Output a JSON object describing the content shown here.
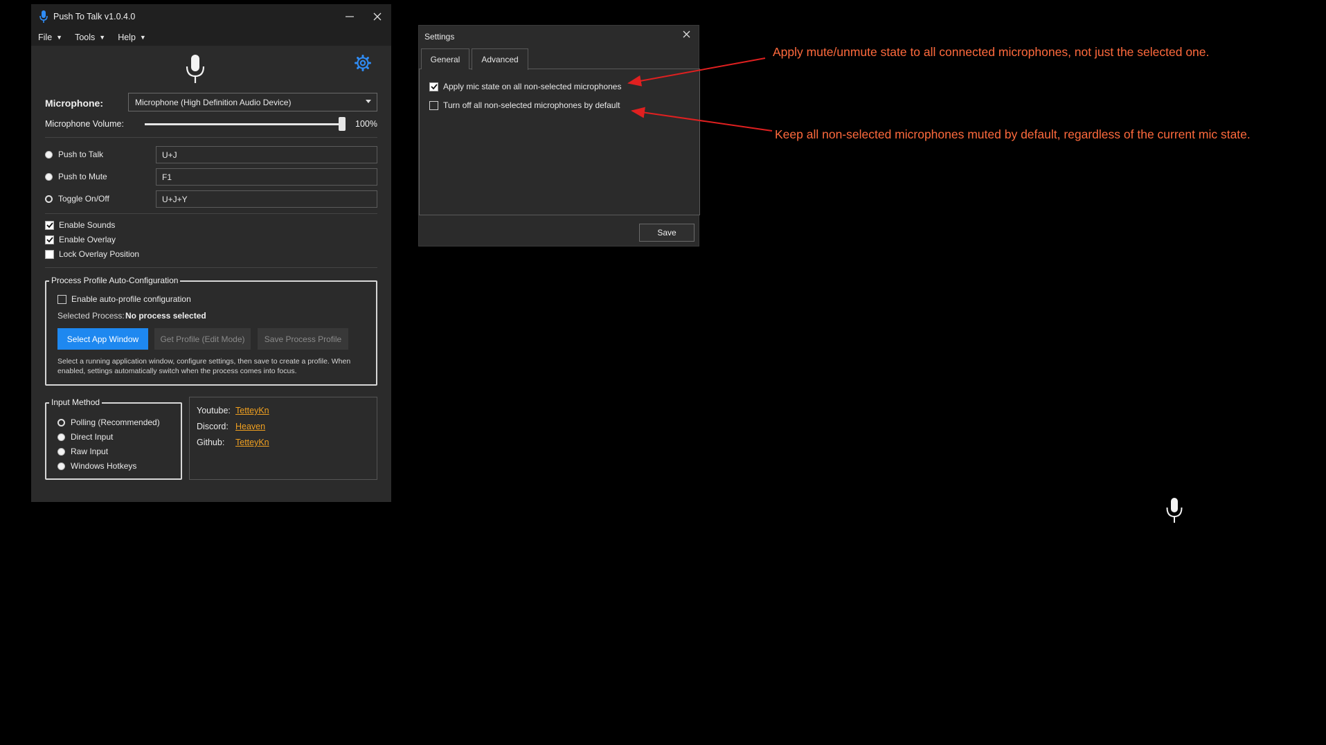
{
  "main_window": {
    "title": "Push To Talk v1.0.4.0",
    "menu": [
      "File",
      "Tools",
      "Help"
    ],
    "microphone_label": "Microphone:",
    "microphone_selected": "Microphone (High Definition Audio Device)",
    "volume_label": "Microphone Volume:",
    "volume_value": "100%",
    "volume_level": 1.0,
    "modes": [
      {
        "label": "Push to Talk",
        "hotkey": "U+J",
        "selected": false
      },
      {
        "label": "Push to Mute",
        "hotkey": "F1",
        "selected": false
      },
      {
        "label": "Toggle On/Off",
        "hotkey": "U+J+Y",
        "selected": true
      }
    ],
    "options": [
      {
        "label": "Enable Sounds",
        "checked": true
      },
      {
        "label": "Enable Overlay",
        "checked": true
      },
      {
        "label": "Lock Overlay Position",
        "checked": false
      }
    ],
    "profile_group": {
      "title": "Process Profile Auto-Configuration",
      "enable_label": "Enable auto-profile configuration",
      "enable_checked": false,
      "selected_process_label": "Selected Process:",
      "selected_process_value": "No process selected",
      "select_button": "Select App Window",
      "get_button": "Get Profile (Edit Mode)",
      "save_button": "Save Process Profile",
      "help": "Select a running application window, configure settings, then save to create a profile. When enabled, settings automatically switch when the process comes into focus."
    },
    "input_method": {
      "title": "Input Method",
      "options": [
        "Polling (Recommended)",
        "Direct Input",
        "Raw Input",
        "Windows Hotkeys"
      ],
      "selected": 0
    },
    "links": [
      {
        "label": "Youtube:",
        "value": "TetteyKn"
      },
      {
        "label": "Discord:",
        "value": "Heaven"
      },
      {
        "label": "Github:",
        "value": "TetteyKn"
      }
    ]
  },
  "settings": {
    "title": "Settings",
    "tabs": [
      "General",
      "Advanced"
    ],
    "active_tab": 1,
    "options": [
      {
        "label": "Apply mic state on all non-selected microphones",
        "checked": true
      },
      {
        "label": "Turn off all non-selected microphones by default",
        "checked": false
      }
    ],
    "save_label": "Save"
  },
  "annotations": [
    "Apply mute/unmute state to all connected microphones, not just the selected one.",
    "Keep all non-selected microphones muted by default, regardless of the current mic state."
  ],
  "colors": {
    "accent": "#1e88f0",
    "link": "#f0a020",
    "annotation": "#ff6a3d",
    "arrow": "#e02020"
  }
}
